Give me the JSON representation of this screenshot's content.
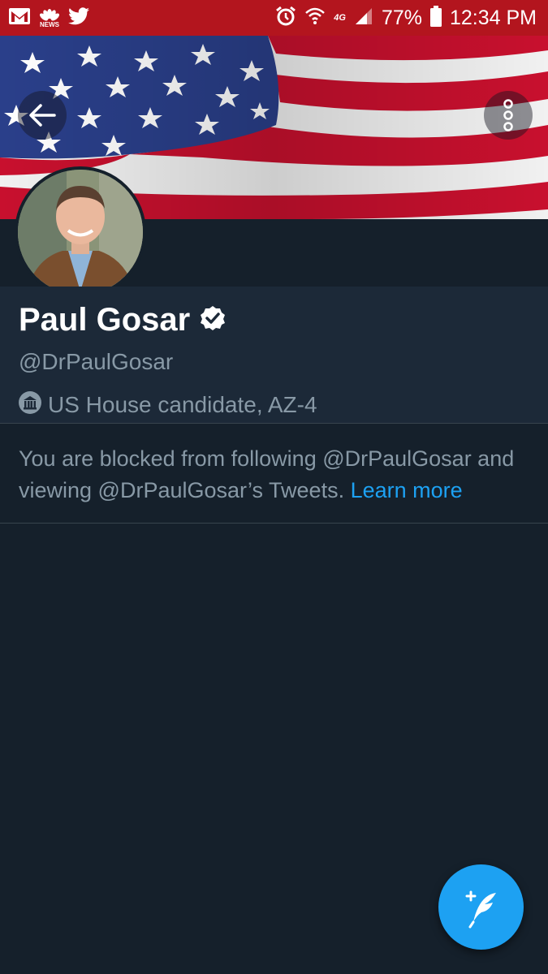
{
  "status_bar": {
    "icons": [
      "gmail-icon",
      "nbc-news-icon",
      "twitter-icon",
      "alarm-icon",
      "wifi-icon",
      "4g-icon",
      "signal-icon",
      "battery-icon"
    ],
    "network_label": "4G",
    "nbc_label": "NEWS",
    "battery": "77%",
    "time": "12:34 PM",
    "background": "#b3151e"
  },
  "profile": {
    "name": "Paul Gosar",
    "handle": "@DrPaulGosar",
    "bio": "US House candidate, AZ-4",
    "verified": true
  },
  "blocked_notice": {
    "text": "You are blocked from following @DrPaulGosar and viewing @DrPaulGosar’s Tweets.",
    "link": "Learn more"
  },
  "colors": {
    "background": "#15202b",
    "panel": "#1c2938",
    "secondary_text": "#8899a6",
    "accent": "#1da1f2"
  }
}
